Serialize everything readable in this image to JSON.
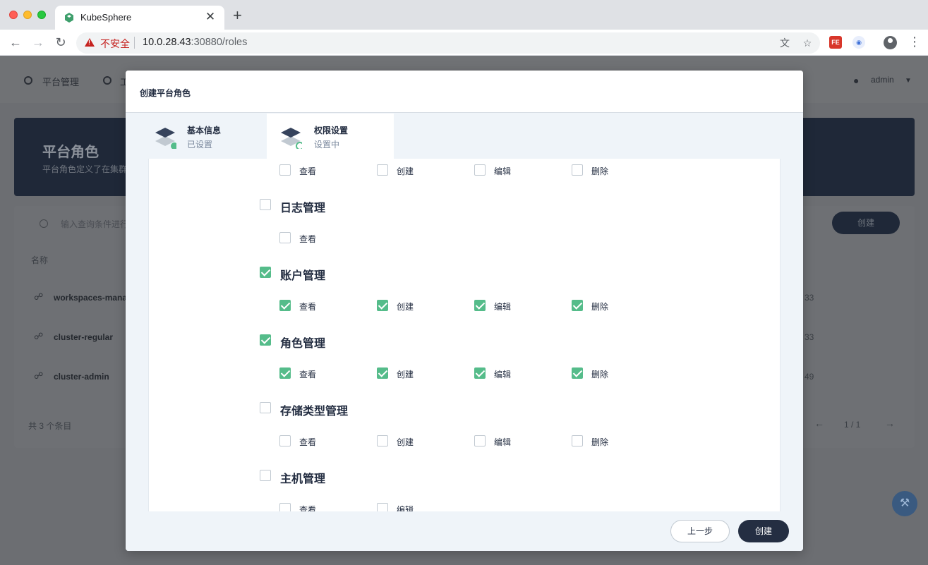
{
  "browser": {
    "tab_title": "KubeSphere",
    "insecure_label": "不安全",
    "url_host": "10.0.28.43",
    "url_path": ":30880/roles"
  },
  "background": {
    "nav_platform": "平台管理",
    "nav_second": "工",
    "user": "admin",
    "banner_title": "平台角色",
    "banner_desc": "平台角色定义了在集群",
    "search_placeholder": "输入查询条件进行",
    "create_label": "创建",
    "column_name": "名称",
    "rows": [
      {
        "name": "workspaces-manag",
        "time": "33"
      },
      {
        "name": "cluster-regular",
        "time": "33"
      },
      {
        "name": "cluster-admin",
        "time": "49"
      }
    ],
    "total": "共 3 个条目",
    "pager": "1 / 1"
  },
  "modal": {
    "title": "创建平台角色",
    "steps": [
      {
        "title": "基本信息",
        "status": "已设置"
      },
      {
        "title": "权限设置",
        "status": "设置中"
      }
    ],
    "prev_label": "上一步",
    "create_label": "创建"
  },
  "permissions": {
    "partial_group": [
      {
        "label": "查看",
        "checked": false
      },
      {
        "label": "创建",
        "checked": false
      },
      {
        "label": "编辑",
        "checked": false
      },
      {
        "label": "删除",
        "checked": false
      }
    ],
    "groups": [
      {
        "title": "日志管理",
        "checked": false,
        "items": [
          {
            "label": "查看",
            "checked": false
          }
        ]
      },
      {
        "title": "账户管理",
        "checked": true,
        "items": [
          {
            "label": "查看",
            "checked": true
          },
          {
            "label": "创建",
            "checked": true
          },
          {
            "label": "编辑",
            "checked": true
          },
          {
            "label": "删除",
            "checked": true
          }
        ]
      },
      {
        "title": "角色管理",
        "checked": true,
        "items": [
          {
            "label": "查看",
            "checked": true
          },
          {
            "label": "创建",
            "checked": true
          },
          {
            "label": "编辑",
            "checked": true
          },
          {
            "label": "删除",
            "checked": true
          }
        ]
      },
      {
        "title": "存储类型管理",
        "checked": false,
        "items": [
          {
            "label": "查看",
            "checked": false
          },
          {
            "label": "创建",
            "checked": false
          },
          {
            "label": "编辑",
            "checked": false
          },
          {
            "label": "删除",
            "checked": false
          }
        ]
      },
      {
        "title": "主机管理",
        "checked": false,
        "items": [
          {
            "label": "查看",
            "checked": false
          },
          {
            "label": "编辑",
            "checked": false
          }
        ]
      }
    ]
  },
  "colors": {
    "accent_green": "#55bc8a",
    "dark": "#242e42"
  }
}
